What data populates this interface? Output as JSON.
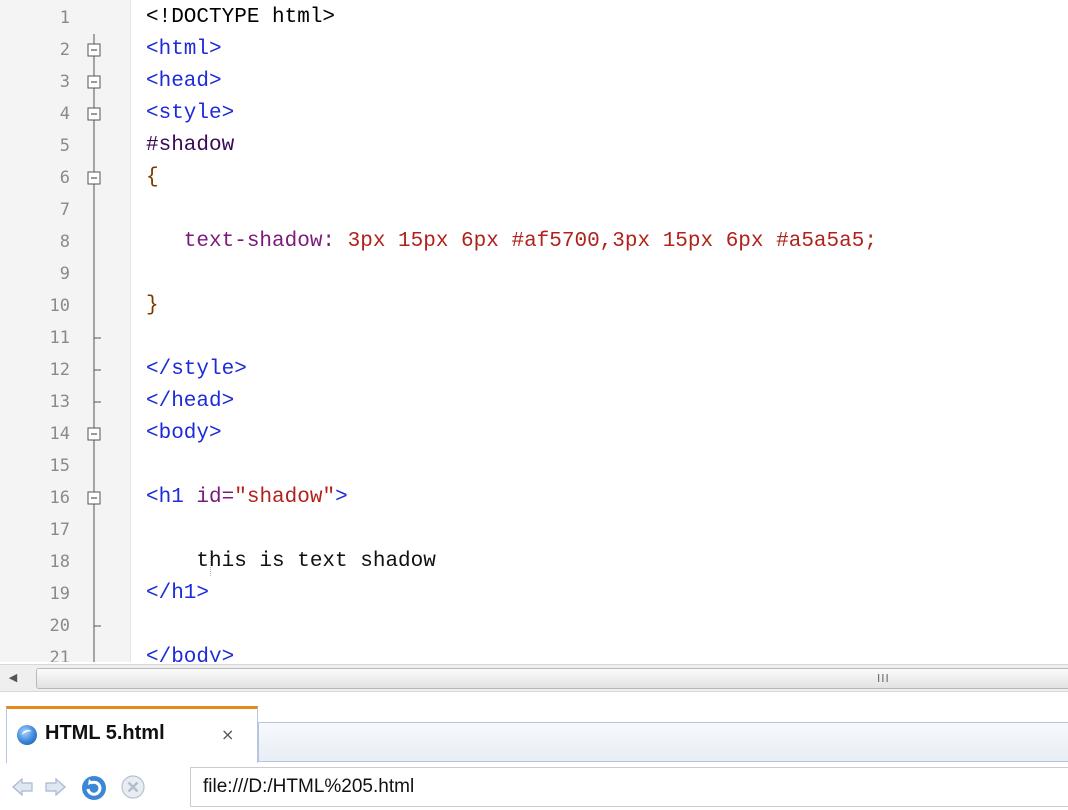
{
  "editor": {
    "lines": [
      {
        "n": "1",
        "fold": "none",
        "tokens": [
          {
            "c": "t-doc",
            "t": "<!DOCTYPE html>"
          }
        ]
      },
      {
        "n": "2",
        "fold": "open",
        "tokens": [
          {
            "c": "t-tag",
            "t": "<html>"
          }
        ]
      },
      {
        "n": "3",
        "fold": "open",
        "tokens": [
          {
            "c": "t-tag",
            "t": "<head>"
          }
        ]
      },
      {
        "n": "4",
        "fold": "open",
        "tokens": [
          {
            "c": "t-tag",
            "t": "<style>"
          }
        ]
      },
      {
        "n": "5",
        "fold": "line",
        "tokens": [
          {
            "c": "t-sel",
            "t": "#shadow"
          }
        ]
      },
      {
        "n": "6",
        "fold": "open",
        "tokens": [
          {
            "c": "t-brace",
            "t": "{"
          }
        ]
      },
      {
        "n": "7",
        "fold": "line",
        "tokens": []
      },
      {
        "n": "8",
        "fold": "line",
        "tokens": [
          {
            "c": "t-prop",
            "t": "   text-shadow: "
          },
          {
            "c": "t-val",
            "t": "3px 15px 6px #af5700,3px 15px 6px #a5a5a5;"
          }
        ]
      },
      {
        "n": "9",
        "fold": "line",
        "tokens": []
      },
      {
        "n": "10",
        "fold": "line",
        "tokens": [
          {
            "c": "t-brace",
            "t": "}"
          }
        ]
      },
      {
        "n": "11",
        "fold": "end",
        "tokens": []
      },
      {
        "n": "12",
        "fold": "end",
        "tokens": [
          {
            "c": "t-tag",
            "t": "</style>"
          }
        ]
      },
      {
        "n": "13",
        "fold": "end",
        "tokens": [
          {
            "c": "t-tag",
            "t": "</head>"
          }
        ]
      },
      {
        "n": "14",
        "fold": "open",
        "tokens": [
          {
            "c": "t-tag",
            "t": "<body>"
          }
        ]
      },
      {
        "n": "15",
        "fold": "line",
        "tokens": []
      },
      {
        "n": "16",
        "fold": "open",
        "tokens": [
          {
            "c": "t-tag",
            "t": "<h1 "
          },
          {
            "c": "t-attr",
            "t": "id="
          },
          {
            "c": "t-str",
            "t": "\"shadow\""
          },
          {
            "c": "t-tag",
            "t": ">"
          }
        ]
      },
      {
        "n": "17",
        "fold": "line",
        "tokens": []
      },
      {
        "n": "18",
        "fold": "line",
        "tokens": [
          {
            "c": "t-text",
            "t": "    this is text shadow"
          }
        ]
      },
      {
        "n": "19",
        "fold": "line",
        "tokens": [
          {
            "c": "t-tag",
            "t": "</h1>"
          }
        ]
      },
      {
        "n": "20",
        "fold": "end",
        "tokens": []
      },
      {
        "n": "21",
        "fold": "line",
        "tokens": [
          {
            "c": "t-tag",
            "t": "</body>"
          }
        ]
      }
    ]
  },
  "scrollbar": {
    "grip": "III"
  },
  "tab": {
    "label": "HTML 5.html",
    "close": "×",
    "active_accent": "#e48a1c"
  },
  "nav": {
    "url": "file:///D:/HTML%205.html",
    "buttons": [
      "back-arrow-icon",
      "forward-arrow-icon",
      "refresh-icon",
      "stop-icon"
    ]
  }
}
